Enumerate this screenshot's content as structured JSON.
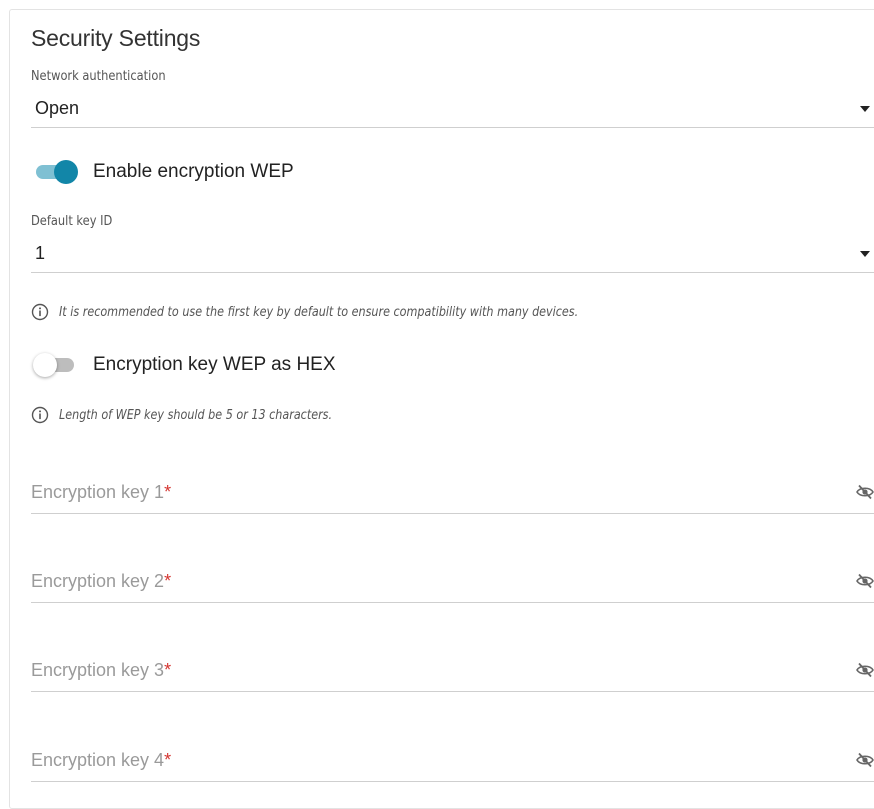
{
  "section": {
    "title": "Security Settings"
  },
  "network_authentication": {
    "label": "Network authentication",
    "value": "Open"
  },
  "enable_wep": {
    "label": "Enable encryption WEP",
    "enabled": true
  },
  "default_key_id": {
    "label": "Default key ID",
    "value": "1"
  },
  "hints": {
    "default_key": "It is recommended to use the first key by default to ensure compatibility with many devices.",
    "key_length": "Length of WEP key should be 5 or 13 characters."
  },
  "wep_hex": {
    "label": "Encryption key WEP as HEX",
    "enabled": false
  },
  "keys": [
    {
      "placeholder": "Encryption key 1",
      "required_mark": "*",
      "value": ""
    },
    {
      "placeholder": "Encryption key 2",
      "required_mark": "*",
      "value": ""
    },
    {
      "placeholder": "Encryption key 3",
      "required_mark": "*",
      "value": ""
    },
    {
      "placeholder": "Encryption key 4",
      "required_mark": "*",
      "value": ""
    }
  ],
  "icons": {
    "info": "info-circle-icon",
    "visibility": "eye-off-icon",
    "dropdown": "caret-down-icon"
  },
  "colors": {
    "accent": "#1286a8",
    "accent_track": "#7fc0d3",
    "required": "#d4332f",
    "placeholder": "#9a9a9a"
  }
}
